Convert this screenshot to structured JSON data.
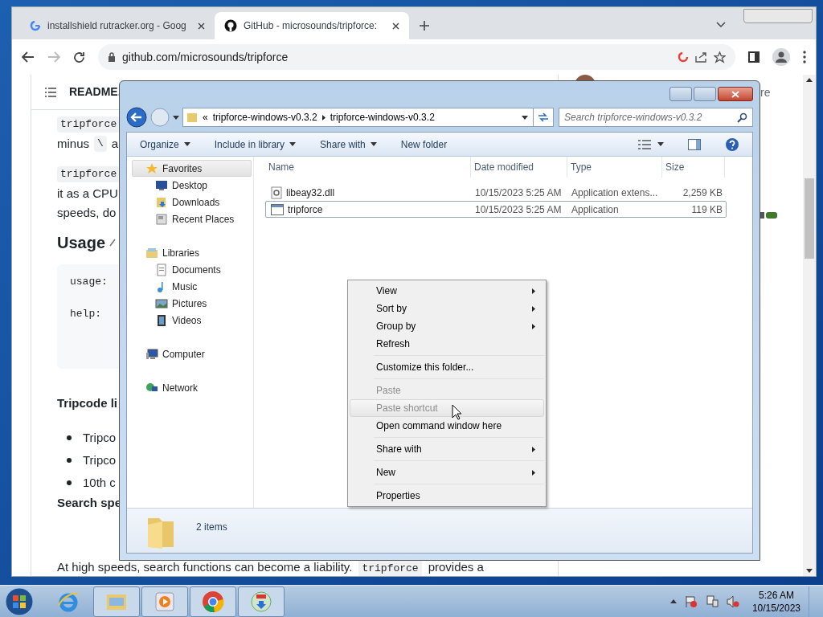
{
  "browser": {
    "tabs": [
      {
        "title": "installshield rutracker.org - Goog",
        "selected": false
      },
      {
        "title": "GitHub - microsounds/tripforce:",
        "selected": true
      }
    ],
    "address": "github.com/microsounds/tripforce",
    "readme": {
      "header": "README.",
      "peek": "re",
      "lines": [
        {
          "kind": "code",
          "text": "tripforce"
        },
        {
          "kind": "mixed",
          "parts": [
            "minus",
            "\\",
            "a"
          ]
        },
        {
          "kind": "code",
          "text": "tripforce"
        },
        {
          "kind": "text",
          "text": "it as a CPU"
        },
        {
          "kind": "text",
          "text": "speeds, do"
        },
        {
          "kind": "heading",
          "text": "Usage"
        },
        {
          "kind": "codeblock",
          "parts": [
            "usage:",
            "help:"
          ]
        },
        {
          "kind": "bold",
          "text": "Tripcode li"
        },
        {
          "kind": "bullet",
          "text": "Tripco"
        },
        {
          "kind": "bullet",
          "text": "Tripco"
        },
        {
          "kind": "bullet",
          "text": "10th c"
        },
        {
          "kind": "bold",
          "text": "Search spe"
        }
      ],
      "bottom": [
        "At high speeds, search functions can become a liability.",
        "tripforce",
        "provides a"
      ]
    }
  },
  "explorer": {
    "path_overflow": "«",
    "path": [
      "tripforce-windows-v0.3.2",
      "tripforce-windows-v0.3.2"
    ],
    "search_placeholder": "Search tripforce-windows-v0.3.2",
    "toolbar": [
      {
        "label": "Organize",
        "dropdown": true
      },
      {
        "label": "Include in library",
        "dropdown": true
      },
      {
        "label": "Share with",
        "dropdown": true
      },
      {
        "label": "New folder",
        "dropdown": false
      }
    ],
    "nav": [
      {
        "label": "Favorites",
        "selected": true,
        "children": [
          {
            "label": "Desktop",
            "selected": false
          },
          {
            "label": "Downloads",
            "selected": false
          },
          {
            "label": "Recent Places",
            "selected": false
          }
        ]
      },
      {
        "label": "Libraries",
        "selected": false,
        "children": [
          {
            "label": "Documents",
            "selected": false
          },
          {
            "label": "Music",
            "selected": false
          },
          {
            "label": "Pictures",
            "selected": false
          },
          {
            "label": "Videos",
            "selected": false
          }
        ]
      },
      {
        "label": "Computer",
        "selected": false
      },
      {
        "label": "Network",
        "selected": false
      }
    ],
    "columns": [
      "Name",
      "Date modified",
      "Type",
      "Size"
    ],
    "files": [
      {
        "name": "libeay32.dll",
        "kind": "dll",
        "date": "10/15/2023 5:25 AM",
        "type": "Application extens...",
        "size": "2,259 KB",
        "selected": false
      },
      {
        "name": "tripforce",
        "kind": "exe",
        "date": "10/15/2023 5:25 AM",
        "type": "Application",
        "size": "119 KB",
        "selected": true
      }
    ],
    "status": "2 items"
  },
  "context_menu": [
    {
      "kind": "item",
      "label": "View",
      "submenu": true,
      "disabled": false,
      "highlighted": false
    },
    {
      "kind": "item",
      "label": "Sort by",
      "submenu": true,
      "disabled": false,
      "highlighted": false
    },
    {
      "kind": "item",
      "label": "Group by",
      "submenu": true,
      "disabled": false,
      "highlighted": false
    },
    {
      "kind": "item",
      "label": "Refresh",
      "submenu": false,
      "disabled": false,
      "highlighted": false
    },
    {
      "kind": "separator"
    },
    {
      "kind": "item",
      "label": "Customize this folder...",
      "submenu": false,
      "disabled": false,
      "highlighted": false
    },
    {
      "kind": "separator"
    },
    {
      "kind": "item",
      "label": "Paste",
      "submenu": false,
      "disabled": true,
      "highlighted": false
    },
    {
      "kind": "item",
      "label": "Paste shortcut",
      "submenu": false,
      "disabled": true,
      "highlighted": true
    },
    {
      "kind": "item",
      "label": "Open command window here",
      "submenu": false,
      "disabled": false,
      "highlighted": false
    },
    {
      "kind": "separator"
    },
    {
      "kind": "item",
      "label": "Share with",
      "submenu": true,
      "disabled": false,
      "highlighted": false
    },
    {
      "kind": "separator"
    },
    {
      "kind": "item",
      "label": "New",
      "submenu": true,
      "disabled": false,
      "highlighted": false
    },
    {
      "kind": "separator"
    },
    {
      "kind": "item",
      "label": "Properties",
      "submenu": false,
      "disabled": false,
      "highlighted": false
    }
  ],
  "taskbar": {
    "apps": [
      {
        "kind": "ie",
        "open": false
      },
      {
        "kind": "explorer",
        "open": true
      },
      {
        "kind": "media",
        "open": true
      },
      {
        "kind": "chrome",
        "open": true
      },
      {
        "kind": "installer",
        "open": true
      }
    ],
    "time": "5:26 AM",
    "date": "10/15/2023"
  }
}
